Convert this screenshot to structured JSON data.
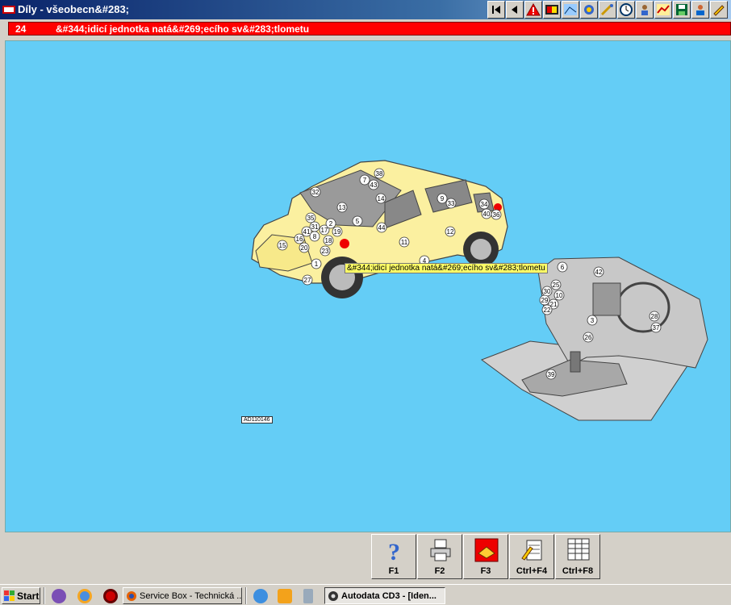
{
  "window": {
    "title": "Díly - všeobecn&#283;"
  },
  "toolbar": {
    "buttons": [
      "first-icon",
      "prev-icon",
      "warning-icon",
      "flag-icon",
      "diagram-icon",
      "gear-icon",
      "tools-icon",
      "clock-icon",
      "person-icon",
      "chart-icon",
      "save-icon",
      "help-person-icon",
      "edit-icon"
    ]
  },
  "header": {
    "number": "24",
    "title": "&#344;idicí jednotka natá&#269;ecího sv&#283;tlometu"
  },
  "diagram": {
    "tooltip": "&#344;idicí jednotka natá&#269;ecího sv&#283;tlometu",
    "ref_label": "AD110146",
    "car_callouts": [
      "38",
      "7",
      "43",
      "32",
      "14",
      "9",
      "33",
      "34",
      "40",
      "36",
      "13",
      "35",
      "5",
      "44",
      "31",
      "41",
      "17",
      "19",
      "16",
      "8",
      "18",
      "2",
      "15",
      "20",
      "23",
      "11",
      "12",
      "1",
      "4",
      "27"
    ],
    "dash_callouts": [
      "6",
      "42",
      "25",
      "30",
      "10",
      "29",
      "21",
      "22",
      "28",
      "3",
      "37",
      "26",
      "39"
    ]
  },
  "fkeys": [
    {
      "icon": "help-icon",
      "label": "F1"
    },
    {
      "icon": "print-icon",
      "label": "F2"
    },
    {
      "icon": "component-icon",
      "label": "F3"
    },
    {
      "icon": "notes-icon",
      "label": "Ctrl+F4"
    },
    {
      "icon": "list-icon",
      "label": "Ctrl+F8"
    }
  ],
  "taskbar": {
    "start_label": "Start",
    "tasks": [
      {
        "label": "Service Box - Technická ..."
      },
      {
        "label": "Autodata CD3 - [Iden..."
      }
    ]
  }
}
